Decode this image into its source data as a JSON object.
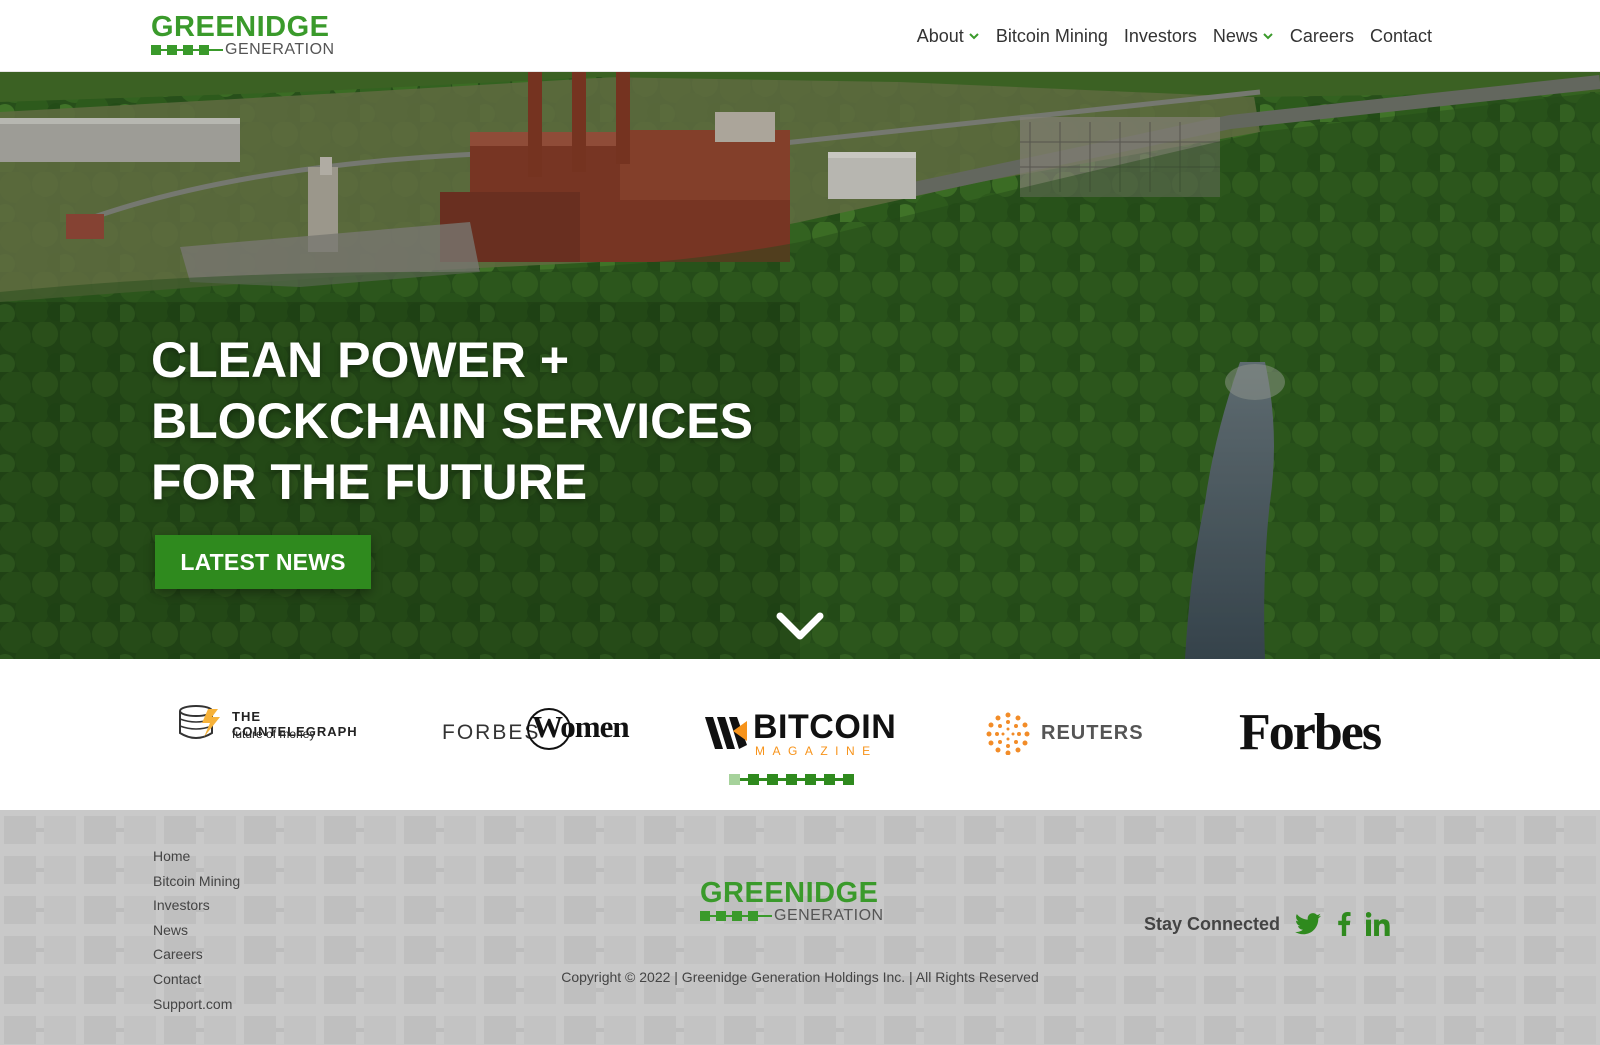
{
  "header": {
    "logo": {
      "word": "GREENIDGE",
      "sub": "GENERATION"
    },
    "nav": [
      {
        "label": "About",
        "has_dropdown": true
      },
      {
        "label": "Bitcoin Mining",
        "has_dropdown": false
      },
      {
        "label": "Investors",
        "has_dropdown": false
      },
      {
        "label": "News",
        "has_dropdown": true
      },
      {
        "label": "Careers",
        "has_dropdown": false
      },
      {
        "label": "Contact",
        "has_dropdown": false
      }
    ]
  },
  "hero": {
    "title_lines": [
      "CLEAN POWER +",
      "BLOCKCHAIN SERVICES",
      "FOR THE FUTURE"
    ],
    "cta_label": "LATEST NEWS",
    "scroll_icon": "chevron-down-icon"
  },
  "press": {
    "logos": [
      {
        "name": "THE COINTELEGRAPH",
        "tagline": "future of money"
      },
      {
        "name_a": "FORBES",
        "name_b": "Women"
      },
      {
        "name": "BITCOIN",
        "sub": "MAGAZINE"
      },
      {
        "name": "REUTERS"
      },
      {
        "name": "Forbes"
      }
    ],
    "carousel_active_index": 0,
    "carousel_count": 7
  },
  "footer": {
    "links": [
      "Home",
      "Bitcoin Mining",
      "Investors",
      "News",
      "Careers",
      "Contact",
      "Support.com"
    ],
    "logo": {
      "word": "GREENIDGE",
      "sub": "GENERATION"
    },
    "copyright": "Copyright © 2022 | Greenidge Generation Holdings Inc. | All Rights Reserved",
    "stay_connected": "Stay Connected",
    "social": [
      "twitter-icon",
      "facebook-icon",
      "linkedin-icon"
    ]
  },
  "colors": {
    "brand_green": "#3a9a2b",
    "button_green": "#2f8a1e",
    "footer_bg": "#c9c9c9",
    "bitcoin_orange": "#f7931a",
    "reuters_orange": "#f28c28"
  }
}
